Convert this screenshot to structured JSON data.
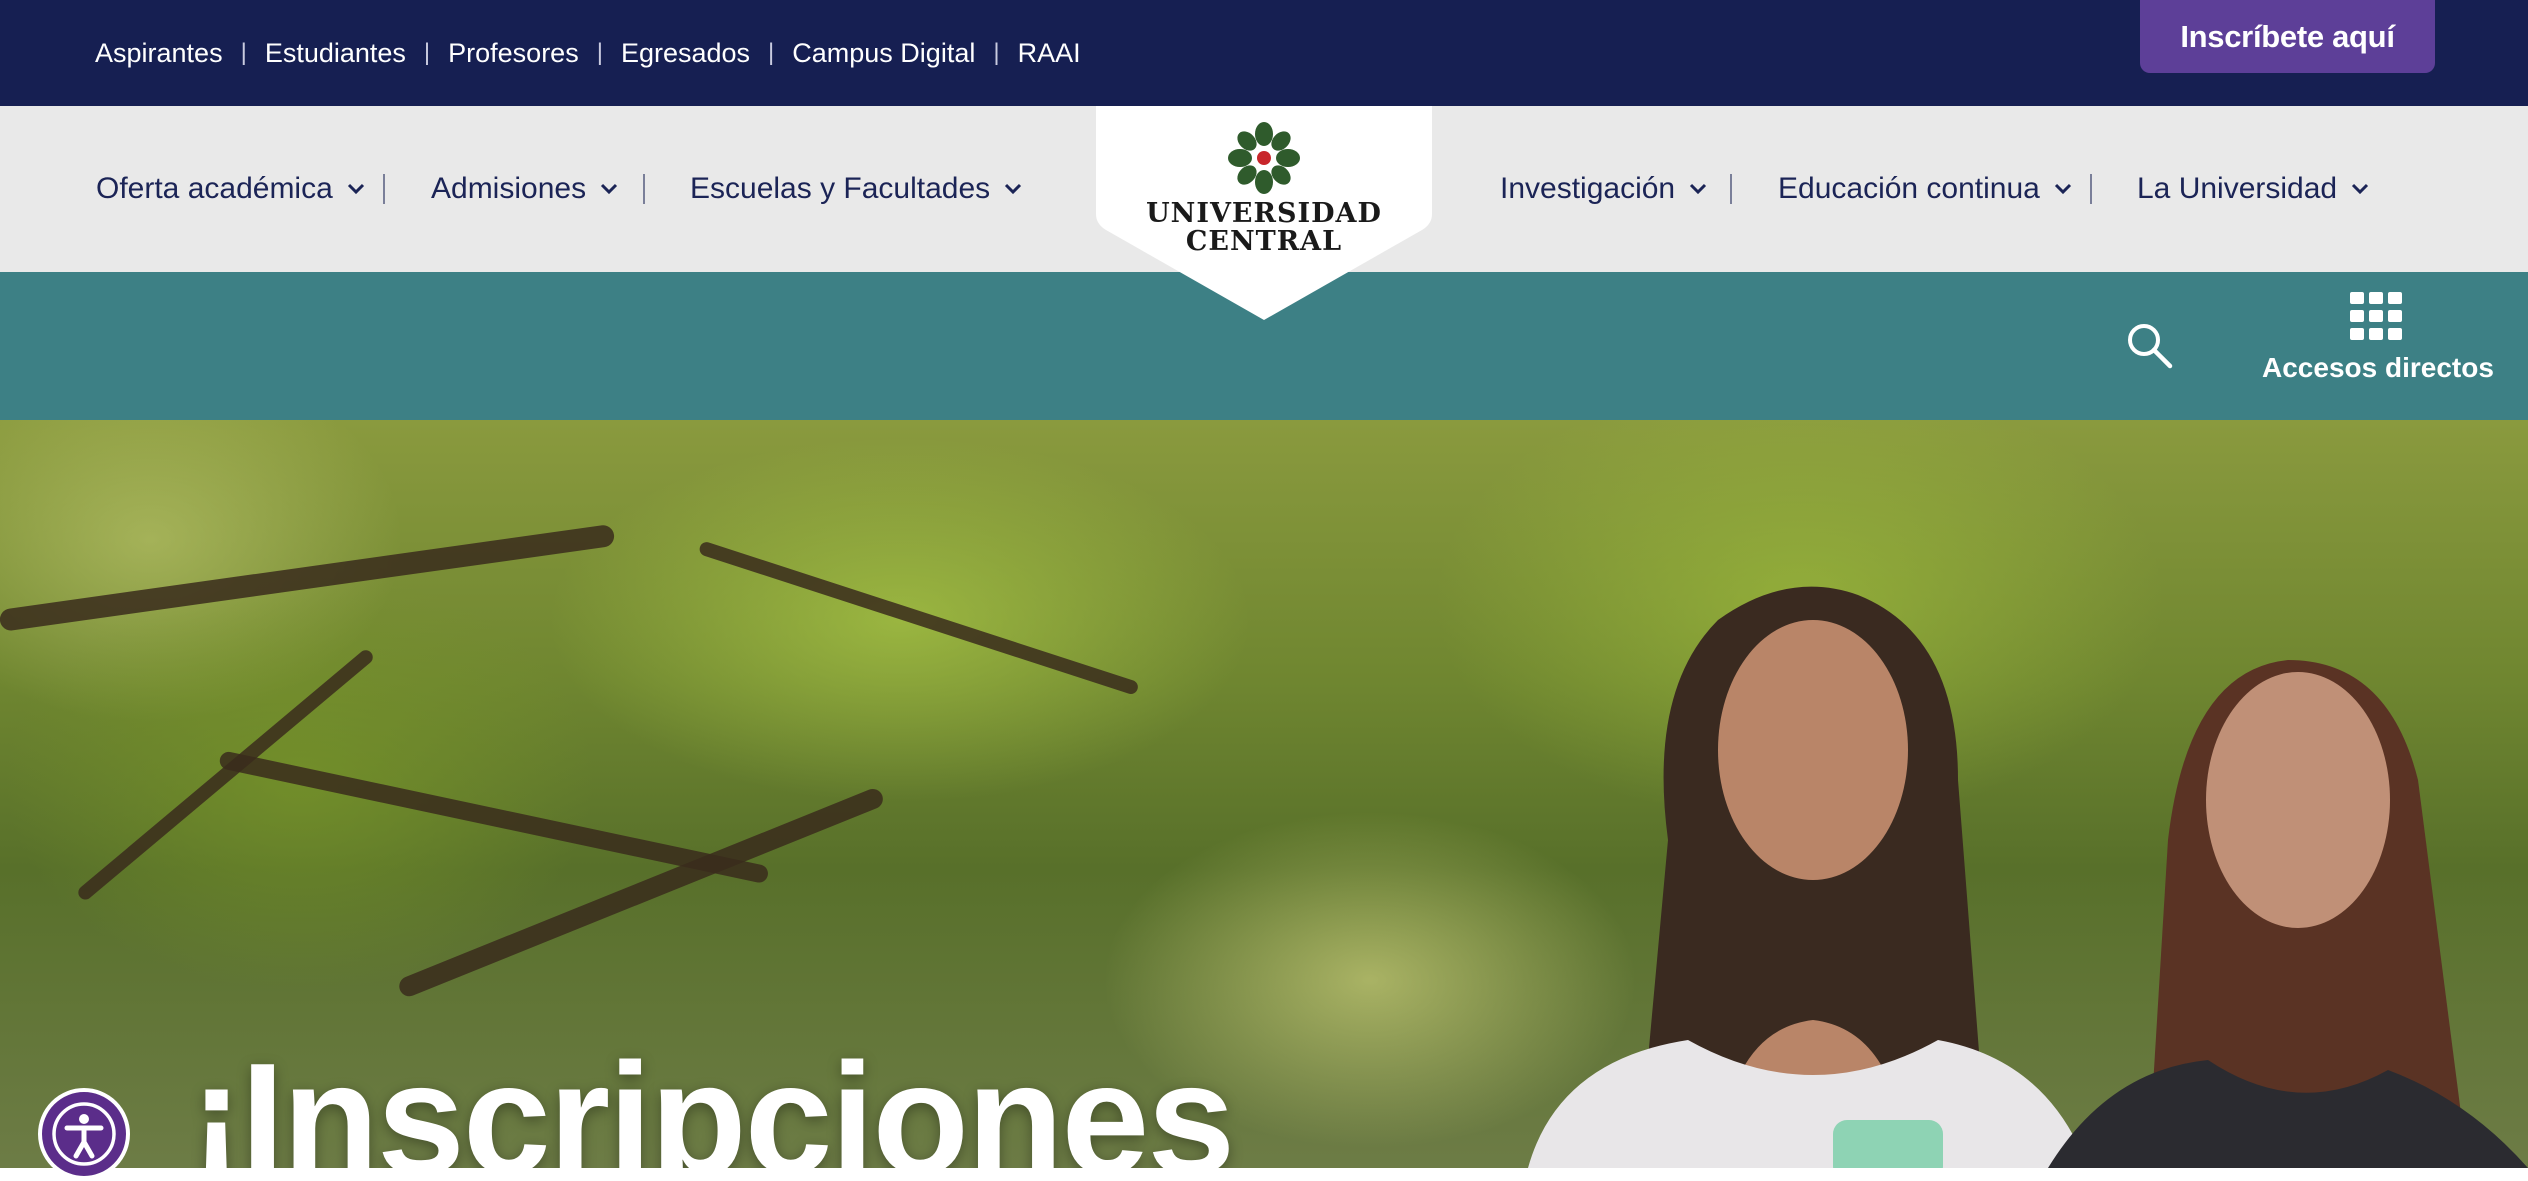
{
  "topbar": {
    "links": [
      "Aspirantes",
      "Estudiantes",
      "Profesores",
      "Egresados",
      "Campus Digital",
      "RAAI"
    ],
    "separator": "|",
    "cta_label": "Inscríbete aquí"
  },
  "nav": {
    "left": [
      "Oferta académica",
      "Admisiones",
      "Escuelas y Facultades"
    ],
    "right": [
      "Investigación",
      "Educación continua",
      "La Universidad"
    ],
    "icon": "chevron-down-icon"
  },
  "logo": {
    "line1": "UNIVERSIDAD",
    "line2": "CENTRAL"
  },
  "toolbar": {
    "search_icon": "search-icon",
    "shortcuts_icon": "grid-icon",
    "shortcuts_label": "Accesos directos"
  },
  "hero": {
    "title": "¡Inscripciones"
  },
  "colors": {
    "topbar": "#161f52",
    "cta": "#5d3f98",
    "nav_bg": "#e9e9e9",
    "nav_text": "#1b2456",
    "teal": "#3d8085",
    "accessibility": "#5b2d8a"
  }
}
